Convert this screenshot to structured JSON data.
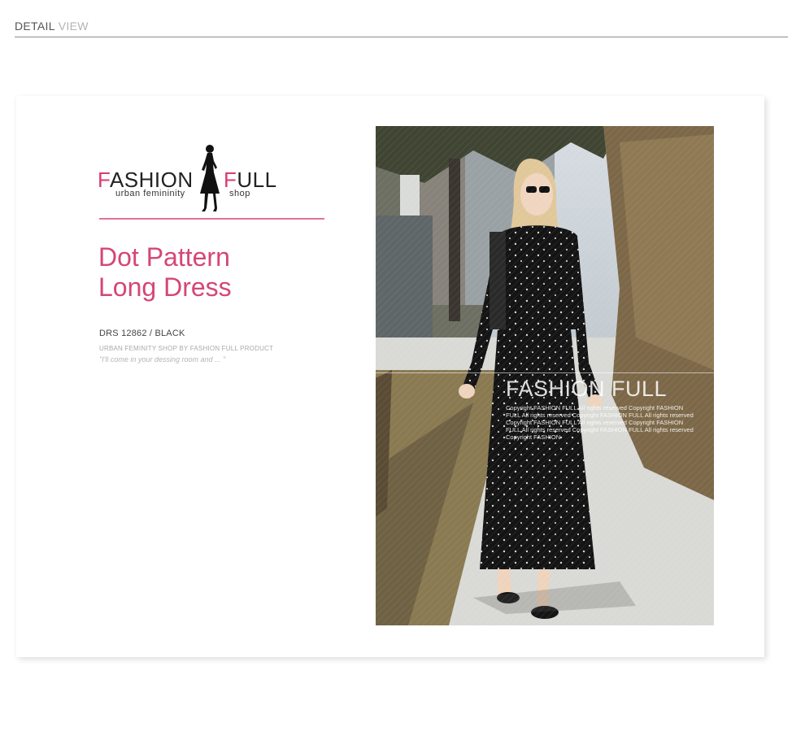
{
  "header": {
    "title_strong": "DETAIL",
    "title_light": "VIEW"
  },
  "logo": {
    "brand_left_first": "F",
    "brand_left_rest": "ASHION",
    "brand_right_first": "F",
    "brand_right_rest": "ULL",
    "tagline_left": "urban femininity",
    "tagline_right": "shop"
  },
  "product": {
    "title_line1": "Dot Pattern",
    "title_line2": "Long Dress",
    "sku": "DRS 12862 / BLACK",
    "credit": "URBAN FEMINITY SHOP BY  FASHION FULL PRODUCT",
    "quote": "\"I'll come in your dessing room and ... \""
  },
  "photo": {
    "watermark_title": "FASHION FULL",
    "watermark_text": "Copyright  FASHION  FULL  All  rights  reserved  Copyright FASHION FULL All  rights  reserved  Copyright  FASHION  FULL  All  rights  reserved Copyright FASHION FULL All rights reserved Copyright FASHION FULL All rights reserved Copyright FASHION FULL All rights reserved Copyright FASHION"
  },
  "colors": {
    "accent_pink": "#d44775",
    "divider_pink": "#e1729b"
  }
}
